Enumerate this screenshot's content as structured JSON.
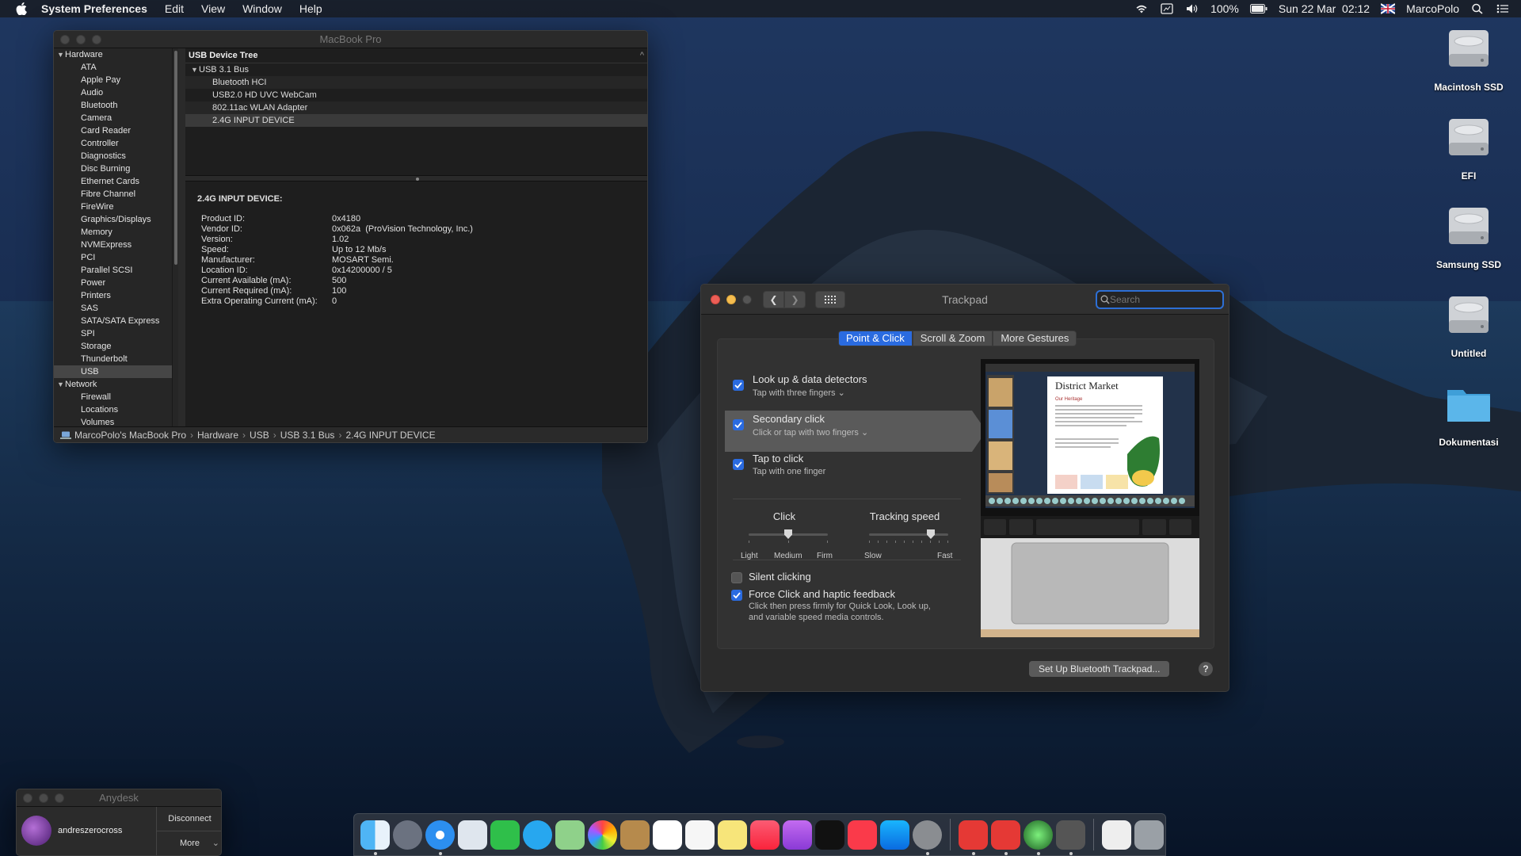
{
  "menubar": {
    "app_name": "System Preferences",
    "menus": [
      "Edit",
      "View",
      "Window",
      "Help"
    ],
    "battery": "100%",
    "datetime": "Sun 22 Mar  02:12",
    "user": "MarcoPolo"
  },
  "desktop_icons": [
    {
      "label": "Macintosh SSD"
    },
    {
      "label": "EFI"
    },
    {
      "label": "Samsung SSD"
    },
    {
      "label": "Untitled"
    },
    {
      "label": "Dokumentasi"
    }
  ],
  "sysinfo": {
    "title": "MacBook Pro",
    "sidebar": [
      {
        "label": "Hardware",
        "type": "header"
      },
      {
        "label": "ATA"
      },
      {
        "label": "Apple Pay"
      },
      {
        "label": "Audio"
      },
      {
        "label": "Bluetooth"
      },
      {
        "label": "Camera"
      },
      {
        "label": "Card Reader"
      },
      {
        "label": "Controller"
      },
      {
        "label": "Diagnostics"
      },
      {
        "label": "Disc Burning"
      },
      {
        "label": "Ethernet Cards"
      },
      {
        "label": "Fibre Channel"
      },
      {
        "label": "FireWire"
      },
      {
        "label": "Graphics/Displays"
      },
      {
        "label": "Memory"
      },
      {
        "label": "NVMExpress"
      },
      {
        "label": "PCI"
      },
      {
        "label": "Parallel SCSI"
      },
      {
        "label": "Power"
      },
      {
        "label": "Printers"
      },
      {
        "label": "SAS"
      },
      {
        "label": "SATA/SATA Express"
      },
      {
        "label": "SPI"
      },
      {
        "label": "Storage"
      },
      {
        "label": "Thunderbolt"
      },
      {
        "label": "USB",
        "selected": true
      },
      {
        "label": "Network",
        "type": "header"
      },
      {
        "label": "Firewall"
      },
      {
        "label": "Locations"
      },
      {
        "label": "Volumes"
      }
    ],
    "tree_header": "USB Device Tree",
    "tree": [
      {
        "label": "USB 3.1 Bus",
        "level": 0
      },
      {
        "label": "Bluetooth HCI",
        "level": 1
      },
      {
        "label": "USB2.0 HD UVC WebCam",
        "level": 1
      },
      {
        "label": "802.11ac WLAN Adapter",
        "level": 1
      },
      {
        "label": "2.4G INPUT DEVICE",
        "level": 1,
        "selected": true
      }
    ],
    "detail_title": "2.4G INPUT DEVICE:",
    "properties": [
      {
        "k": "Product ID:",
        "v": "0x4180"
      },
      {
        "k": "Vendor ID:",
        "v": "0x062a  (ProVision Technology, Inc.)"
      },
      {
        "k": "Version:",
        "v": "1.02"
      },
      {
        "k": "Speed:",
        "v": "Up to 12 Mb/s"
      },
      {
        "k": "Manufacturer:",
        "v": "MOSART Semi."
      },
      {
        "k": "Location ID:",
        "v": "0x14200000 / 5"
      },
      {
        "k": "Current Available (mA):",
        "v": "500"
      },
      {
        "k": "Current Required (mA):",
        "v": "100"
      },
      {
        "k": "Extra Operating Current (mA):",
        "v": "0"
      }
    ],
    "path": [
      "MarcoPolo's MacBook Pro",
      "Hardware",
      "USB",
      "USB 3.1 Bus",
      "2.4G INPUT DEVICE"
    ]
  },
  "trackpad": {
    "title": "Trackpad",
    "search_placeholder": "Search",
    "tabs": [
      {
        "label": "Point & Click",
        "active": true
      },
      {
        "label": "Scroll & Zoom"
      },
      {
        "label": "More Gestures"
      }
    ],
    "options": [
      {
        "title": "Look up & data detectors",
        "sub": "Tap with three fingers",
        "checked": true
      },
      {
        "title": "Secondary click",
        "sub": "Click or tap with two fingers",
        "checked": true
      },
      {
        "title": "Tap to click",
        "sub": "Tap with one finger",
        "checked": true
      }
    ],
    "click": {
      "label": "Click",
      "low": "Light",
      "mid": "Medium",
      "high": "Firm",
      "level": 0.5
    },
    "tracking": {
      "label": "Tracking speed",
      "low": "Slow",
      "high": "Fast",
      "level": 0.78
    },
    "silent_clicking": {
      "label": "Silent clicking",
      "checked": false
    },
    "force_click": {
      "label": "Force Click and haptic feedback",
      "desc1": "Click then press firmly for Quick Look, Look up,",
      "desc2": "and variable speed media controls.",
      "checked": true
    },
    "preview_heading": "District Market",
    "preview_sub": "Our Heritage",
    "bluetooth_button": "Set Up Bluetooth Trackpad...",
    "help": "?"
  },
  "anydesk": {
    "title": "Anydesk",
    "user": "andreszerocross",
    "disconnect": "Disconnect",
    "more": "More"
  },
  "colors": {
    "accent": "#2a6be0",
    "window_bg": "#2b2b2b",
    "desktop": "#0b1d36"
  }
}
